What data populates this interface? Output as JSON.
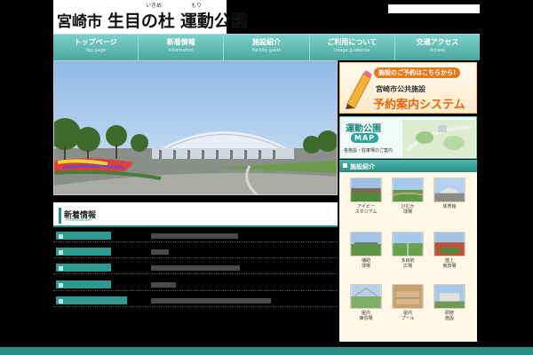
{
  "site": {
    "title_city": "宮崎市",
    "title_main": "生目の杜",
    "title_rest": "運動公園",
    "ruby_ikime": "いきめ",
    "ruby_mori": "もり"
  },
  "nav": [
    {
      "jp": "トップページ",
      "en": "Top page"
    },
    {
      "jp": "新着情報",
      "en": "Information"
    },
    {
      "jp": "施設紹介",
      "en": "Facility guide"
    },
    {
      "jp": "ご利用について",
      "en": "Usage guidance"
    },
    {
      "jp": "交通アクセス",
      "en": "Access"
    }
  ],
  "news": {
    "title": "新着情報",
    "subtitle": "Information"
  },
  "banners": {
    "reserve_tag": "施設のご予約はこちらから!",
    "reserve_line1": "宮崎市公共施設",
    "reserve_line2": "予約案内システム",
    "map_title": "運動公園",
    "map_badge": "MAP",
    "map_desc": "各施設・駐車場のご案内"
  },
  "facilities": {
    "title": "施設紹介",
    "items": [
      {
        "label": "アイビー\nスタジアム"
      },
      {
        "label": "ひむか\n球場"
      },
      {
        "label": "体育館"
      },
      {
        "label": "補助\n球場"
      },
      {
        "label": "多目的\n広場"
      },
      {
        "label": "陸上\n競技場"
      },
      {
        "label": "屋内\n練習場"
      },
      {
        "label": "屋内\nプール"
      },
      {
        "label": "研修\n施設"
      }
    ]
  },
  "colors": {
    "accent": "#2a8d84",
    "nav": "#5fbcb3",
    "reserve": "#e8660e"
  }
}
